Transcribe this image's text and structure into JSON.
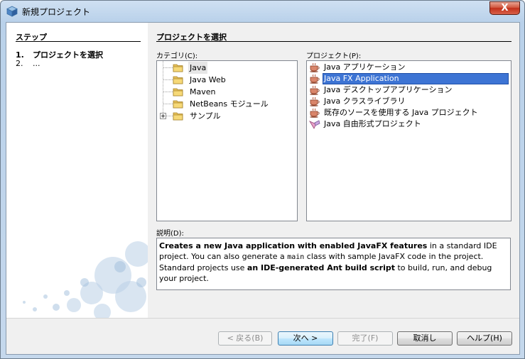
{
  "window": {
    "title": "新規プロジェクト",
    "close_glyph": "X"
  },
  "steps": {
    "title": "ステップ",
    "items": [
      {
        "num": "1.",
        "label": "プロジェクトを選択"
      },
      {
        "num": "2.",
        "label": "..."
      }
    ]
  },
  "main": {
    "title": "プロジェクトを選択",
    "categories_label": "カテゴリ(C):",
    "projects_label": "プロジェクト(P):",
    "description_label": "説明(D):"
  },
  "categories": [
    {
      "label": "Java",
      "selected": true
    },
    {
      "label": "Java Web"
    },
    {
      "label": "Maven"
    },
    {
      "label": "NetBeans モジュール"
    },
    {
      "label": "サンプル",
      "expandable": true
    }
  ],
  "projects": [
    {
      "label": "Java アプリケーション",
      "icon": "java-cup-icon"
    },
    {
      "label": "Java FX Application",
      "icon": "java-cup-icon",
      "selected": true
    },
    {
      "label": "Java デスクトップアプリケーション",
      "icon": "java-cup-icon"
    },
    {
      "label": "Java クラスライブラリ",
      "icon": "java-cup-icon"
    },
    {
      "label": "既存のソースを使用する Java プロジェクト",
      "icon": "java-cup-icon"
    },
    {
      "label": "Java 自由形式プロジェクト",
      "icon": "freeform-project-icon"
    }
  ],
  "description": {
    "p1_bold": "Creates a new Java application with enabled JavaFX features",
    "p1_rest": " in a standard IDE project. You can also generate a ",
    "p1_code": "main",
    "p1_rest2": " class with sample JavaFX code in the project. Standard projects use ",
    "p2_bold": "an IDE-generated Ant build script",
    "p2_rest": " to build, run, and debug your project."
  },
  "buttons": {
    "back": "< 戻る(B)",
    "next": "次へ >",
    "finish": "完了(F)",
    "cancel": "取消し",
    "help": "ヘルプ(H)"
  },
  "colors": {
    "selection": "#3d74d4",
    "close_button": "#c2301a"
  }
}
